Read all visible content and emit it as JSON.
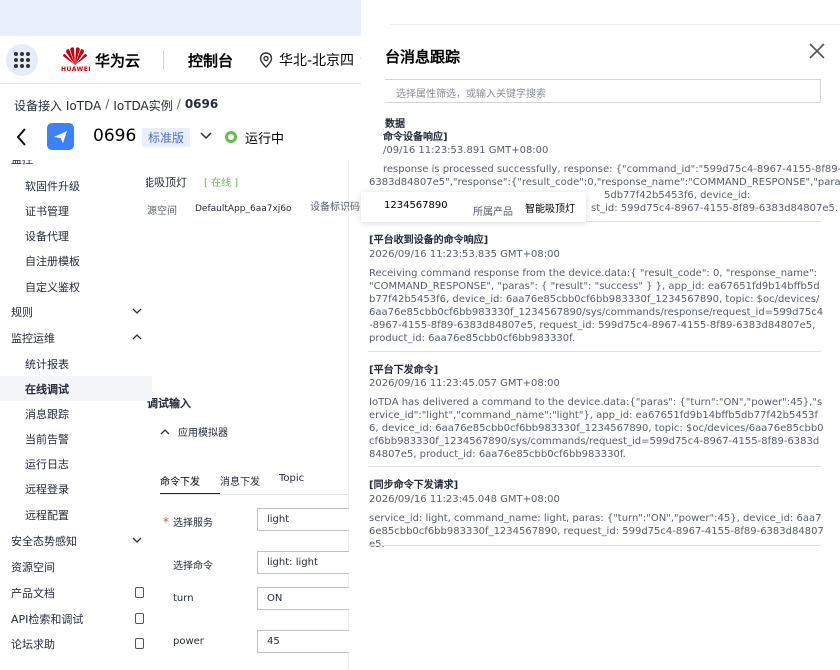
{
  "header": {
    "brand": "华为云",
    "brand_en": "HUAWEI",
    "console": "控制台",
    "region": "华北-北京四"
  },
  "breadcrumb": {
    "items": [
      "设备接入 IoTDA",
      "IoTDA实例",
      "0696"
    ],
    "separator": "/"
  },
  "instance": {
    "name": "0696",
    "edition": "标准版",
    "status": "运行中",
    "status_color": "#5ec24c"
  },
  "sidebar": {
    "cut_item": "监控",
    "items": [
      {
        "label": "软固件升级",
        "kind": "sub"
      },
      {
        "label": "证书管理",
        "kind": "sub"
      },
      {
        "label": "设备代理",
        "kind": "sub"
      },
      {
        "label": "自注册模板",
        "kind": "sub"
      },
      {
        "label": "自定义鉴权",
        "kind": "sub"
      },
      {
        "label": "规则",
        "kind": "top",
        "chevron": "down"
      },
      {
        "label": "监控运维",
        "kind": "top",
        "chevron": "up"
      },
      {
        "label": "统计报表",
        "kind": "sub"
      },
      {
        "label": "在线调试",
        "kind": "sub",
        "active": true
      },
      {
        "label": "消息跟踪",
        "kind": "sub"
      },
      {
        "label": "当前告警",
        "kind": "sub"
      },
      {
        "label": "运行日志",
        "kind": "sub"
      },
      {
        "label": "远程登录",
        "kind": "sub"
      },
      {
        "label": "远程配置",
        "kind": "sub"
      },
      {
        "label": "安全态势感知",
        "kind": "top",
        "chevron": "down"
      },
      {
        "label": "资源空间",
        "kind": "top"
      },
      {
        "label": "产品文档",
        "kind": "top",
        "external": true
      },
      {
        "label": "API检索和调试",
        "kind": "top",
        "external": true
      },
      {
        "label": "论坛求助",
        "kind": "top",
        "external": true
      }
    ]
  },
  "device": {
    "name": "卧室智能吸顶灯",
    "online": "[ 在线 ]",
    "space_label": "所属资源空间",
    "space_value": "DefaultApp_6aa7xj6o",
    "id_label": "设备标识码",
    "product_id": "1234567890",
    "product_label": "所属产品",
    "product_value": "智能吸顶灯"
  },
  "debug": {
    "title": "调试输入",
    "simulator": "应用模拟器",
    "tabs": [
      "命令下发",
      "消息下发",
      "Topic"
    ],
    "form": [
      {
        "label": "选择服务",
        "value": "light",
        "required": true
      },
      {
        "label": "选择命令",
        "value": "light: light"
      },
      {
        "label": "turn",
        "value": "ON"
      },
      {
        "label": "power",
        "value": "45"
      }
    ]
  },
  "drawer": {
    "title": "台消息跟踪",
    "filter_placeholder": "选择属性筛选，或输入关键字搜索",
    "data_head": "数据",
    "entries": [
      {
        "title": "命令设备响应]",
        "time": "/09/16 11:23:53.891 GMT+08:00",
        "line1": "response is processed successfully, response: {\"command_id\":\"599d75c4-8967-4155-8f89-",
        "line2": "6383d84807e5\",\"response\":{\"result_code\":0,\"response_name\":\"COMMAND_RESPONSE\",\"paras\":",
        "mid": "5db77f42b5453f6, device_id:",
        "tail": "st_id: 599d75c4-8967-4155-8f89-6383d84807e5."
      },
      {
        "title": "[平台收到设备的命令响应]",
        "time": "2026/09/16 11:23:53.835 GMT+08:00",
        "body": "Receiving command response from the device.data:{ \"result_code\": 0, \"response_name\": \"COMMAND_RESPONSE\", \"paras\": { \"result\": \"success\" } }, app_id: ea67651fd9b14bffb5db77f42b5453f6, device_id: 6aa76e85cbb0cf6bb983330f_1234567890, topic: $oc/devices/6aa76e85cbb0cf6bb983330f_1234567890/sys/commands/response/request_id=599d75c4-8967-4155-8f89-6383d84807e5, request_id: 599d75c4-8967-4155-8f89-6383d84807e5, product_id: 6aa76e85cbb0cf6bb983330f."
      },
      {
        "title": "[平台下发命令]",
        "time": "2026/09/16 11:23:45.057 GMT+08:00",
        "body": "IoTDA has delivered a command to the device.data:{\"paras\": {\"turn\":\"ON\",\"power\":45},\"service_id\":\"light\",\"command_name\":\"light\"}, app_id: ea67651fd9b14bffb5db77f42b5453f6, device_id: 6aa76e85cbb0cf6bb983330f_1234567890, topic: $oc/devices/6aa76e85cbb0cf6bb983330f_1234567890/sys/commands/request_id=599d75c4-8967-4155-8f89-6383d84807e5, product_id: 6aa76e85cbb0cf6bb983330f."
      },
      {
        "title": "[同步命令下发请求]",
        "time": "2026/09/16 11:23:45.048 GMT+08:00",
        "body": "service_id: light, command_name: light, paras: {\"turn\":\"ON\",\"power\":45}, device_id: 6aa76e85cbb0cf6bb983330f_1234567890, request_id: 599d75c4-8967-4155-8f89-6383d84807e5."
      }
    ]
  }
}
